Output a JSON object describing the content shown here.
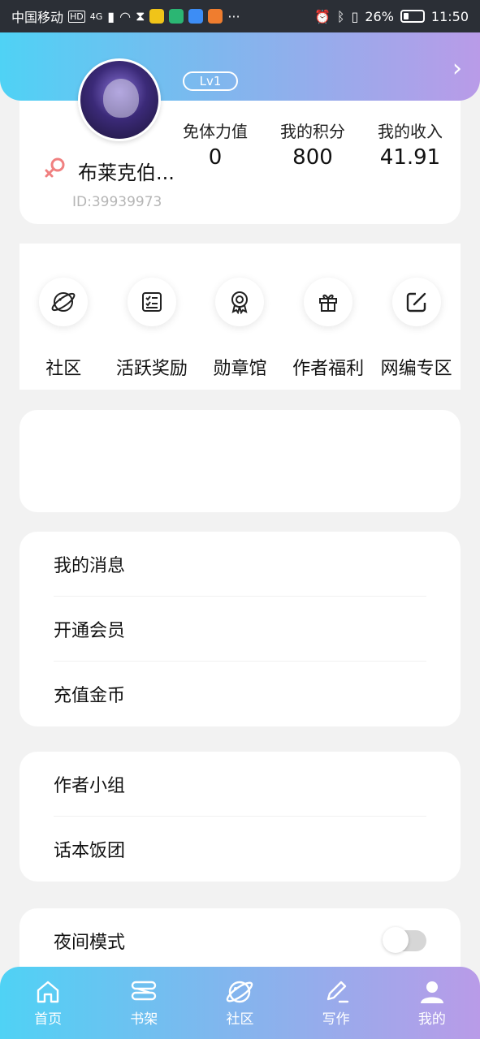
{
  "status_bar": {
    "carrier": "中国移动",
    "network": "4G",
    "battery": "26%",
    "time": "11:50",
    "more": "···"
  },
  "profile": {
    "level": "Lv1",
    "username": "布莱克伯...",
    "user_id": "ID:39939973",
    "gender": "female",
    "stats": [
      {
        "label": "免体力值",
        "value": "0"
      },
      {
        "label": "我的积分",
        "value": "800"
      },
      {
        "label": "我的收入",
        "value": "41.91"
      }
    ]
  },
  "quick_actions": [
    {
      "label": "社区",
      "icon": "planet-icon"
    },
    {
      "label": "活跃奖励",
      "icon": "checklist-icon"
    },
    {
      "label": "勋章馆",
      "icon": "medal-icon"
    },
    {
      "label": "作者福利",
      "icon": "gift-icon"
    },
    {
      "label": "网编专区",
      "icon": "edit-icon"
    }
  ],
  "menu_group_1": [
    "我的消息",
    "开通会员",
    "充值金币"
  ],
  "menu_group_2": [
    "作者小组",
    "话本饭团"
  ],
  "menu_group_3": {
    "night_mode": "夜间模式",
    "night_mode_on": false
  },
  "bottom_nav": [
    {
      "label": "首页",
      "icon": "home-icon"
    },
    {
      "label": "书架",
      "icon": "bookshelf-icon"
    },
    {
      "label": "社区",
      "icon": "planet-icon"
    },
    {
      "label": "写作",
      "icon": "pen-icon"
    },
    {
      "label": "我的",
      "icon": "user-icon"
    }
  ],
  "colors": {
    "gradient_start": "#4fd2f5",
    "gradient_end": "#b99be8",
    "gender_icon": "#f08080"
  }
}
